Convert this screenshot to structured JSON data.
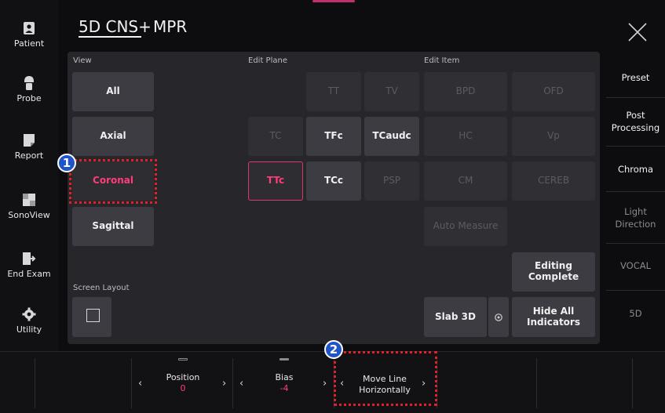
{
  "header": {
    "tabs": [
      {
        "label": "5D CNS+",
        "active": true
      },
      {
        "label": "MPR",
        "active": false
      }
    ]
  },
  "sidebar": {
    "items": [
      {
        "label": "Patient",
        "icon": "patient-icon"
      },
      {
        "label": "Probe",
        "icon": "probe-icon"
      },
      {
        "label": "Report",
        "icon": "report-icon"
      },
      {
        "label": "SonoView",
        "icon": "sonoview-icon"
      },
      {
        "label": "End Exam",
        "icon": "end-exam-icon"
      },
      {
        "label": "Utility",
        "icon": "utility-gear-icon"
      }
    ]
  },
  "view": {
    "label": "View",
    "buttons": [
      "All",
      "Axial",
      "Coronal",
      "Sagittal"
    ],
    "selected": "Coronal"
  },
  "screen_layout": {
    "label": "Screen Layout"
  },
  "edit_plane": {
    "label": "Edit Plane",
    "row1": [
      "TT",
      "TV"
    ],
    "row2": [
      "TC",
      "TFc",
      "TCaudc"
    ],
    "row3": [
      "TTc",
      "TCc",
      "PSP"
    ],
    "selected": "TTc"
  },
  "edit_item": {
    "label": "Edit Item",
    "grid": [
      [
        "BPD",
        "OFD"
      ],
      [
        "HC",
        "Vp"
      ],
      [
        "CM",
        "CEREB"
      ]
    ],
    "auto_measure": "Auto Measure",
    "editing_complete": "Editing Complete",
    "slab_3d": "Slab 3D",
    "hide_all_indicators": "Hide All Indicators"
  },
  "right_sidebar": {
    "items": [
      "Preset",
      "Post Processing",
      "Chroma",
      "Light Direction",
      "VOCAL",
      "5D"
    ],
    "enabled": [
      true,
      true,
      true,
      false,
      false,
      false
    ]
  },
  "bottom_bar": {
    "position": {
      "label": "Position",
      "value": "0"
    },
    "bias": {
      "label": "Bias",
      "value": "-4"
    },
    "move_line": {
      "label": "Move Line Horizontally"
    }
  },
  "annotations": [
    "1",
    "2"
  ],
  "colors": {
    "accent": "#ff3d7a",
    "highlight_box": "#e0202a",
    "badge": "#1f55c8",
    "panel": "#26262b",
    "button": "#3c3c42"
  }
}
